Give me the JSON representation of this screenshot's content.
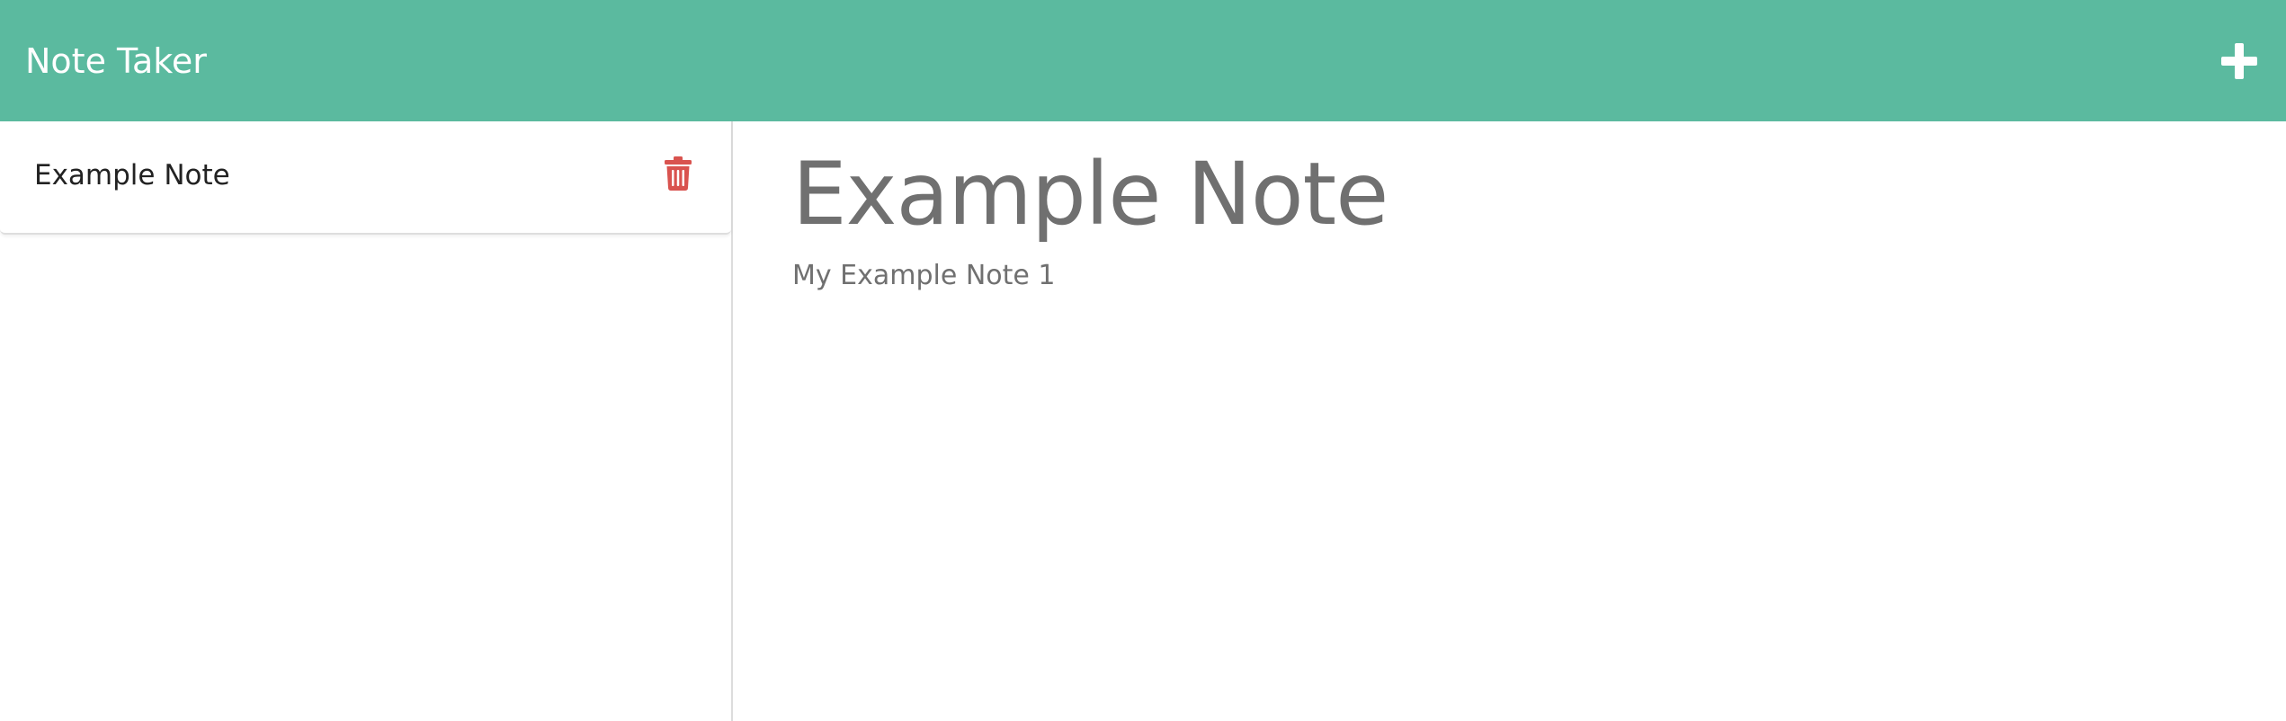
{
  "app": {
    "brand": "Note Taker"
  },
  "colors": {
    "navbar": "#5bba9f",
    "delete_icon": "#d9534f",
    "text_muted": "#707070"
  },
  "icons": {
    "new_note": "plus-icon",
    "delete": "trash-icon"
  },
  "sidebar": {
    "notes": [
      {
        "title": "Example Note"
      }
    ]
  },
  "editor": {
    "title": "Example Note",
    "body": "My Example Note 1"
  }
}
